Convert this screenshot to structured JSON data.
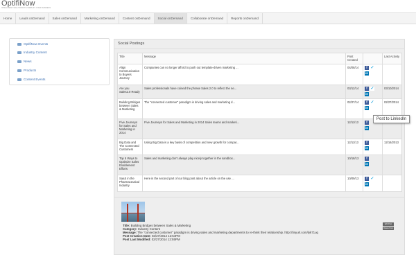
{
  "brand": {
    "name": "OptifiNow",
    "tagline": "INTELLIGENT SOLUTIONS TO SIMPLIFY YOUR BUSINESS"
  },
  "nav": [
    "Home",
    "Leads onDemand",
    "Sales onDemand",
    "Marketing onDemand",
    "Content onDemand",
    "Social onDemand",
    "Collaborate onDemand",
    "Reports onDemand"
  ],
  "active_nav_index": 5,
  "sidebar": [
    {
      "label": "OptifiNow Events"
    },
    {
      "label": "Industry Content"
    },
    {
      "label": "News"
    },
    {
      "label": "Products"
    },
    {
      "label": "Content Events"
    }
  ],
  "panel": {
    "title": "Social Postings",
    "columns": {
      "title": "Title",
      "message": "Message",
      "post_created": "Post Created",
      "actions": "",
      "last_activity": "Last Activity"
    },
    "rows": [
      {
        "title": "Align Communication to Buyers Journey",
        "message": "Companies can no longer afford to push out template-driven marketing ...",
        "created": "04/08/14",
        "last": ""
      },
      {
        "title": "Are you Sales2.0 Ready",
        "message": "Sales professionals have coined the phrase Sales 2.0 to reflect the ne...",
        "created": "03/12/14",
        "last": "03/10/2014"
      },
      {
        "title": "Building Bridges between Sales & Marketing",
        "message": "The \"connected customer\" paradigm is driving sales and marketing d...",
        "created": "02/27/14",
        "last": "02/27/2014"
      },
      {
        "title": "Five Journeys for Sales and Marketing in 2014",
        "message": "Five Journeys for Sales and Marketing in 2014 Sales teams and marketi...",
        "created": "12/11/13",
        "last": ""
      },
      {
        "title": "Big Data and The Connected Customers",
        "message": "Using Big Data is a key basis of competition and new growth for compar...",
        "created": "12/11/13",
        "last": "12/16/2013"
      },
      {
        "title": "Top 5 Ways to Optimize Sales Enablement Efforts",
        "message": "Sales and marketing don't always play nicely together in the sandbox...",
        "created": "10/18/13",
        "last": ""
      },
      {
        "title": "SaaS in the Pharmaceutical Industry",
        "message": "Here is the second part of our blog post about the article on the use ...",
        "created": "10/09/13",
        "last": ""
      }
    ]
  },
  "tooltip": "Post to LinkedIn",
  "details": {
    "title_label": "Title:",
    "title": "Building Bridges between Sales & Marketing",
    "category_label": "Category:",
    "category": "Industry Content",
    "message_label": "Message:",
    "message": "The \"connected customer\" paradigm is driving sales and marketing departments to re-think their relationship. http://tinyurl.com/lyk71uq",
    "created_label": "Post Creation Date:",
    "created": "02/27/2014 12:54PM",
    "modified_label": "Post Last Modified:",
    "modified": "02/27/2014 12:55PM",
    "btn1": "Edit Post",
    "btn2": "Delete Post"
  },
  "icons": {
    "facebook": "facebook-icon",
    "twitter": "twitter-icon",
    "linkedin": "linkedin-icon",
    "folder": "folder-icon"
  },
  "colors": {
    "facebook": "#3b5998",
    "linkedin": "#0077b5",
    "twitter": "#2aa9e0",
    "link": "#3b6fb3"
  }
}
